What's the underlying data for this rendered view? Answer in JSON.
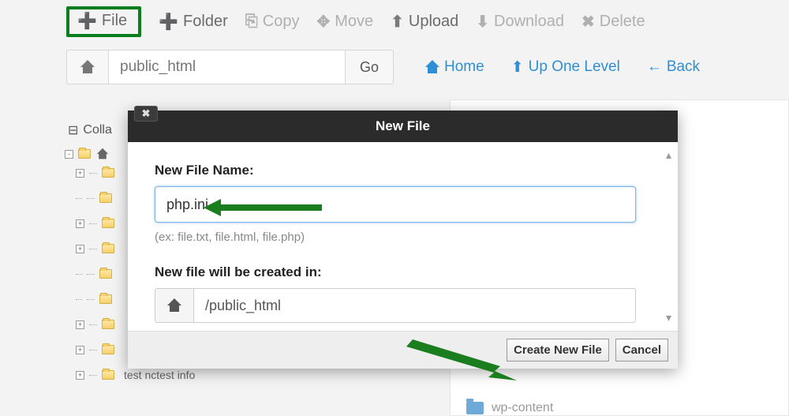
{
  "toolbar": {
    "file": "File",
    "folder": "Folder",
    "copy": "Copy",
    "move": "Move",
    "upload": "Upload",
    "download": "Download",
    "delete": "Delete"
  },
  "pathbar": {
    "path_value": "public_html",
    "go_label": "Go"
  },
  "nav": {
    "home": "Home",
    "up": "Up One Level",
    "back": "Back"
  },
  "tree": {
    "collapse_label": "Colla",
    "bottom_item": "test nctest info"
  },
  "right_panel": {
    "item": "wp-content"
  },
  "modal": {
    "title": "New File",
    "name_label": "New File Name:",
    "name_value": "php.ini",
    "hint": "(ex: file.txt, file.html, file.php)",
    "location_label": "New file will be created in:",
    "location_value": "/public_html",
    "create_label": "Create New File",
    "cancel_label": "Cancel"
  }
}
